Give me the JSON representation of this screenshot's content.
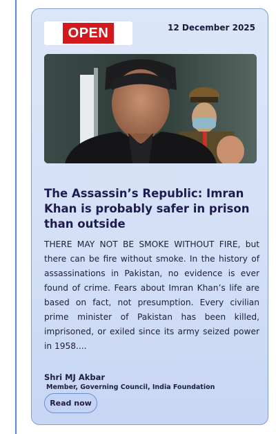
{
  "article": {
    "publication": "OPEN",
    "date": "12 December 2025",
    "title": "The Assassin’s Republic: Imran Khan is probably safer in prison than outside",
    "excerpt": "THERE MAY NOT BE SMOKE WITHOUT FIRE, but there can be fire without smoke. In the history of assassinations in Pakistan, no evidence is ever found of crime. Fears about Imran Khan’s life are based on fact, not presumption. Every civilian prime minister of Pakistan has been killed, imprisoned, or exiled since its army seized power in 1958....",
    "author": "Shri MJ Akbar",
    "author_role": "Member, Governing Council, India Foundation",
    "read_label": "Read now"
  },
  "colors": {
    "card_bg": "#d3e0f6",
    "card_border": "#7f9ed8",
    "title": "#1e1c4e",
    "logo_red": "#d4191e",
    "button_bg": "#c4d3f3"
  }
}
